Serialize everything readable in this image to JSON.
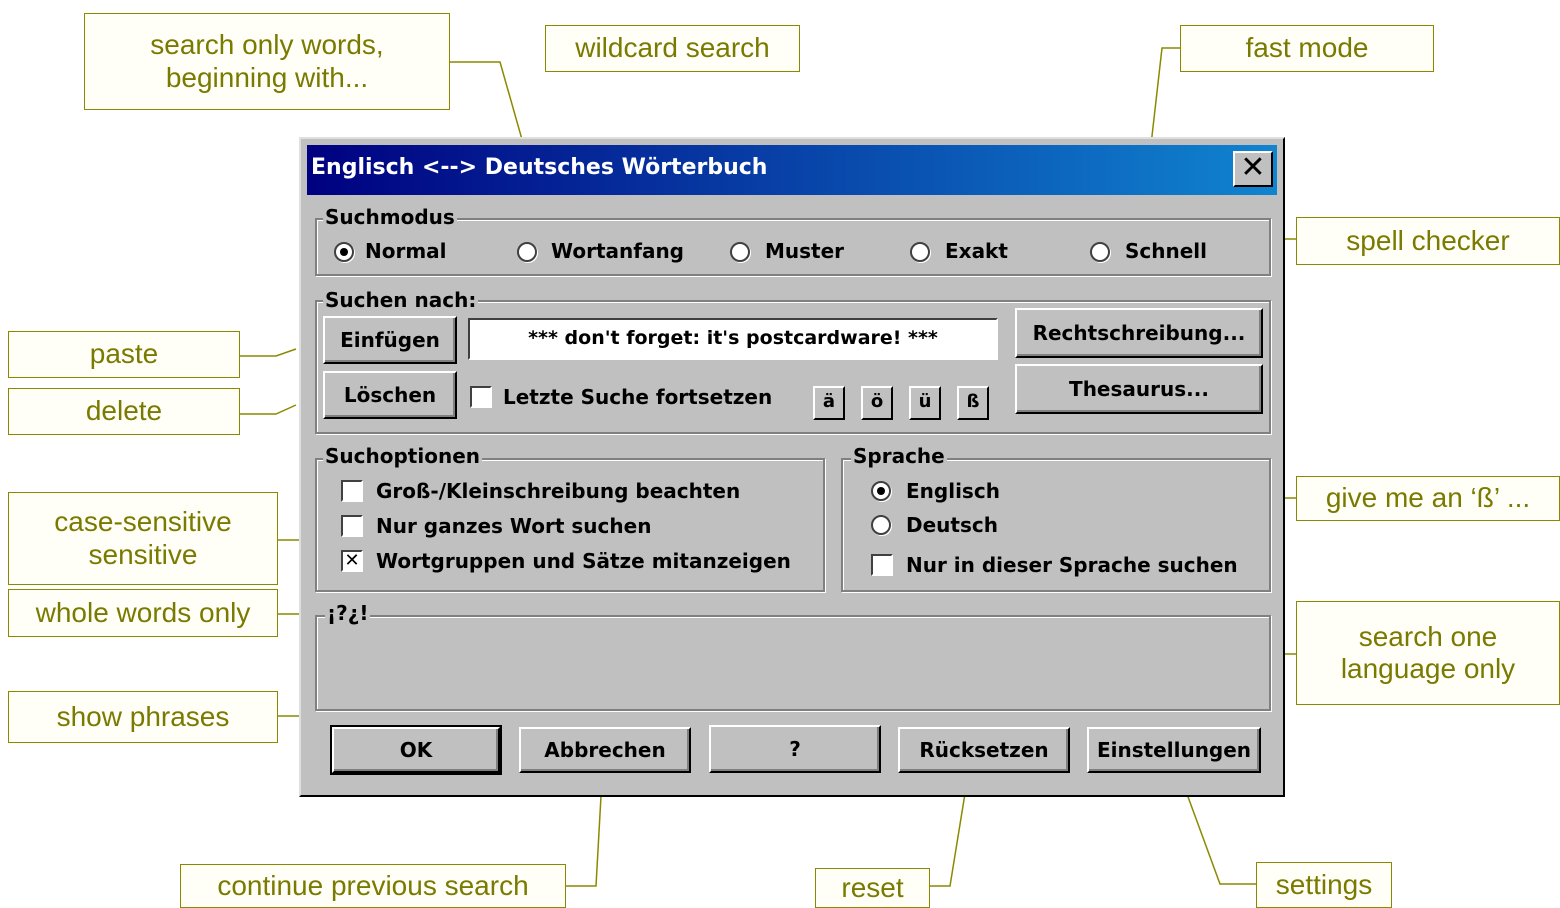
{
  "dialog": {
    "title": "Englisch <--> Deutsches Wörterbuch",
    "close_glyph": "✕"
  },
  "suchmodus": {
    "legend": "Suchmodus",
    "options": [
      "Normal",
      "Wortanfang",
      "Muster",
      "Exakt",
      "Schnell"
    ],
    "selected": "Normal"
  },
  "suchen": {
    "legend": "Suchen nach:",
    "paste_label": "Einfügen",
    "delete_label": "Löschen",
    "input_value": "*** don't forget: it's postcardware! ***",
    "continue_label": "Letzte Suche fortsetzen",
    "continue_checked": false,
    "spell_label": "Rechtschreibung...",
    "thesaurus_label": "Thesaurus...",
    "special_chars": [
      "ä",
      "ö",
      "ü",
      "ß"
    ]
  },
  "suchoptionen": {
    "legend": "Suchoptionen",
    "options": [
      {
        "label": "Groß-/Kleinschreibung beachten",
        "checked": false
      },
      {
        "label": "Nur ganzes Wort suchen",
        "checked": false
      },
      {
        "label": "Wortgruppen und Sätze mitanzeigen",
        "checked": true
      }
    ]
  },
  "sprache": {
    "legend": "Sprache",
    "options": [
      "Englisch",
      "Deutsch"
    ],
    "selected": "Englisch",
    "only_label": "Nur in dieser Sprache suchen",
    "only_checked": false
  },
  "result": {
    "legend": "¡?¿!"
  },
  "buttons": {
    "ok": "OK",
    "cancel": "Abbrechen",
    "help": "?",
    "reset": "Rücksetzen",
    "settings": "Einstellungen"
  },
  "callouts": {
    "search_words_beginning": "search only words,\nbeginning with...",
    "wildcard": "wildcard search",
    "fast_mode": "fast mode",
    "spell_checker": "spell checker",
    "paste": "paste",
    "delete": "delete",
    "case_sensitive": "case-sensitive\nsensitive",
    "whole_words": "whole words only",
    "give_sz": "give me an ‘ß’ ...",
    "one_language": "search one\nlanguage only",
    "show_phrases": "show phrases",
    "continue": "continue previous search",
    "reset": "reset",
    "settings": "settings"
  },
  "colors": {
    "callout_text": "#7a7a00",
    "callout_line": "#8a8a00",
    "title_start": "#000080",
    "title_end": "#1084d0",
    "face": "#c0c0c0"
  }
}
